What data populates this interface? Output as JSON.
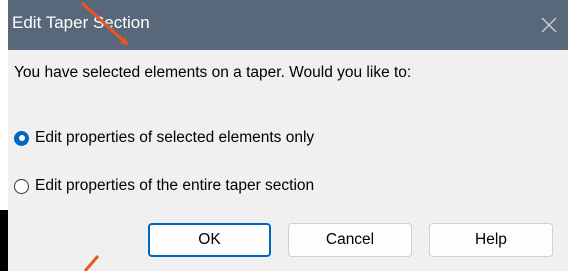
{
  "dialog": {
    "title": "Edit Taper Section",
    "prompt": "You have selected elements on a taper. Would you like to:",
    "options": [
      {
        "label": "Edit properties of selected elements only",
        "selected": true
      },
      {
        "label": "Edit properties of the entire taper section",
        "selected": false
      }
    ],
    "buttons": {
      "ok": "OK",
      "cancel": "Cancel",
      "help": "Help"
    }
  },
  "colors": {
    "titlebar": "#59677a",
    "accent": "#0067c0",
    "annotation_arrow": "#e8571e",
    "dialog_bg": "#f0f0f0"
  },
  "icons": {
    "close": "close-icon",
    "radio_selected": "radio-selected",
    "radio_unselected": "radio-unselected"
  }
}
